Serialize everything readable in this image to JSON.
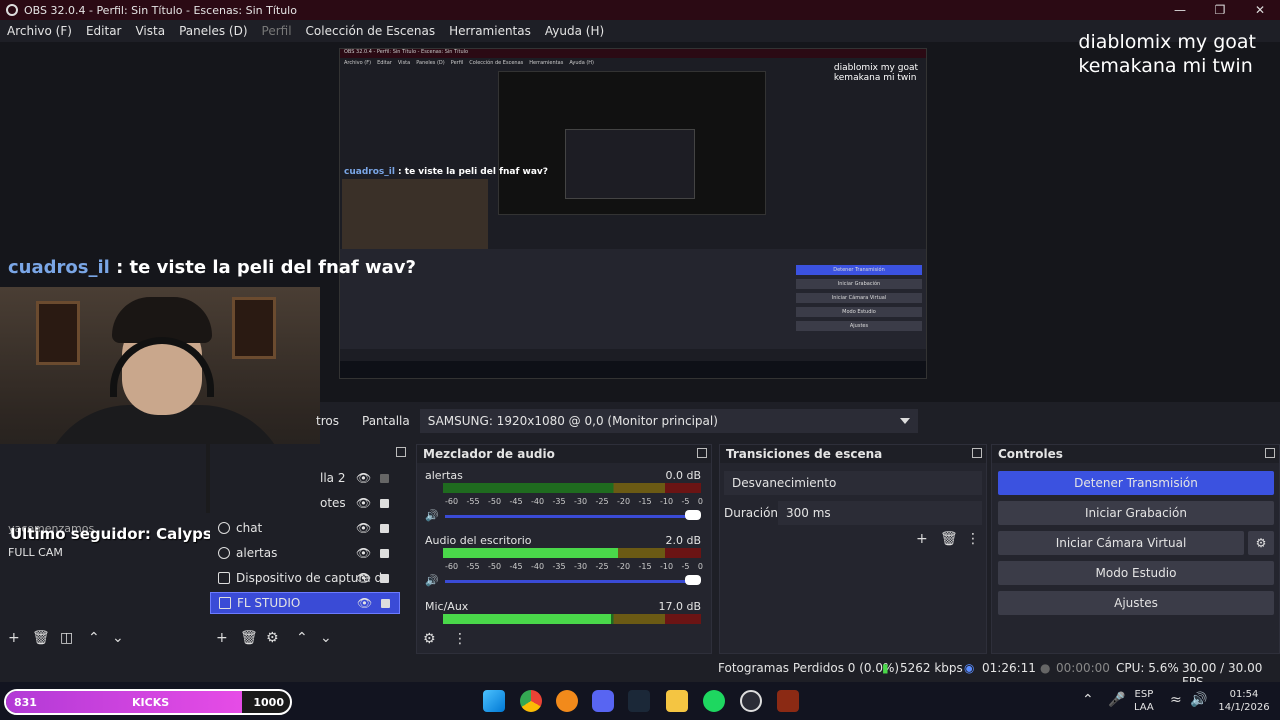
{
  "window": {
    "title": "OBS 32.0.4 - Perfil: Sin Título - Escenas: Sin Título"
  },
  "menu": [
    "Archivo (F)",
    "Editar",
    "Vista",
    "Paneles (D)",
    "Perfil",
    "Colección de Escenas",
    "Herramientas",
    "Ayuda (H)"
  ],
  "overlay": {
    "line1": "diablomix my goat",
    "line2": "kemakana mi twin"
  },
  "chat": {
    "user": "cuadros_il",
    "message": " : te viste la peli del fnaf wav?"
  },
  "follower": {
    "text": "Ultimo seguidor: CalypsoGS"
  },
  "nested": {
    "title": "OBS 32.0.4 - Perfil: Sin Título - Escenas: Sin Título",
    "overlay1": "diablomix my goat",
    "overlay2": "kemakana mi twin",
    "chat_user": "cuadros_il",
    "chat_msg": " : te viste la peli del fnaf wav?",
    "ctrl": [
      "Detener Transmisión",
      "Iniciar Grabación",
      "Iniciar Cámara Virtual",
      "Modo Estudio",
      "Ajustes"
    ]
  },
  "sourcebar": {
    "partial_tab": "tros",
    "label": "Pantalla",
    "monitor": "SAMSUNG: 1920x1080 @ 0,0 (Monitor principal)"
  },
  "scenes": {
    "item1": "yacomenzamos",
    "item2": "FULL CAM"
  },
  "sources": [
    {
      "label": "lla 2"
    },
    {
      "label": "otes"
    },
    {
      "label": "chat"
    },
    {
      "label": "alertas"
    },
    {
      "label": "Dispositivo de captura d"
    },
    {
      "label": "FL STUDIO"
    }
  ],
  "mixer": {
    "title": "Mezclador de audio",
    "scale": [
      "-60",
      "-55",
      "-50",
      "-45",
      "-40",
      "-35",
      "-30",
      "-25",
      "-20",
      "-15",
      "-10",
      "-5",
      "0"
    ],
    "channels": [
      {
        "name": "alertas",
        "db": "0.0 dB",
        "level": 0
      },
      {
        "name": "Audio del escritorio",
        "db": "2.0 dB",
        "level": 0.68
      },
      {
        "name": "Mic/Aux",
        "db": "17.0 dB",
        "level": 0.65
      }
    ]
  },
  "transitions": {
    "title": "Transiciones de escena",
    "type": "Desvanecimiento",
    "duration_label": "Duración",
    "duration": "300 ms"
  },
  "controls": {
    "title": "Controles",
    "buttons": [
      "Detener Transmisión",
      "Iniciar Grabación",
      "Iniciar Cámara Virtual",
      "Modo Estudio",
      "Ajustes"
    ]
  },
  "status": {
    "dropped": "Fotogramas Perdidos 0 (0.0%)",
    "bitrate": "5262 kbps",
    "live": "01:26:11",
    "rec": "00:00:00",
    "cpu": "CPU: 5.6%",
    "fps": "30.00 / 30.00 FPS"
  },
  "kicks": {
    "left": "831",
    "center": "KICKS",
    "right": "1000",
    "progress": 0.831
  },
  "tray": {
    "lang1": "ESP",
    "lang2": "LAA",
    "time": "01:54",
    "date": "14/1/2026"
  },
  "colors": {
    "accent": "#3b52e0",
    "titlebar": "#2b0a14",
    "kicks": "#d64ce6"
  }
}
